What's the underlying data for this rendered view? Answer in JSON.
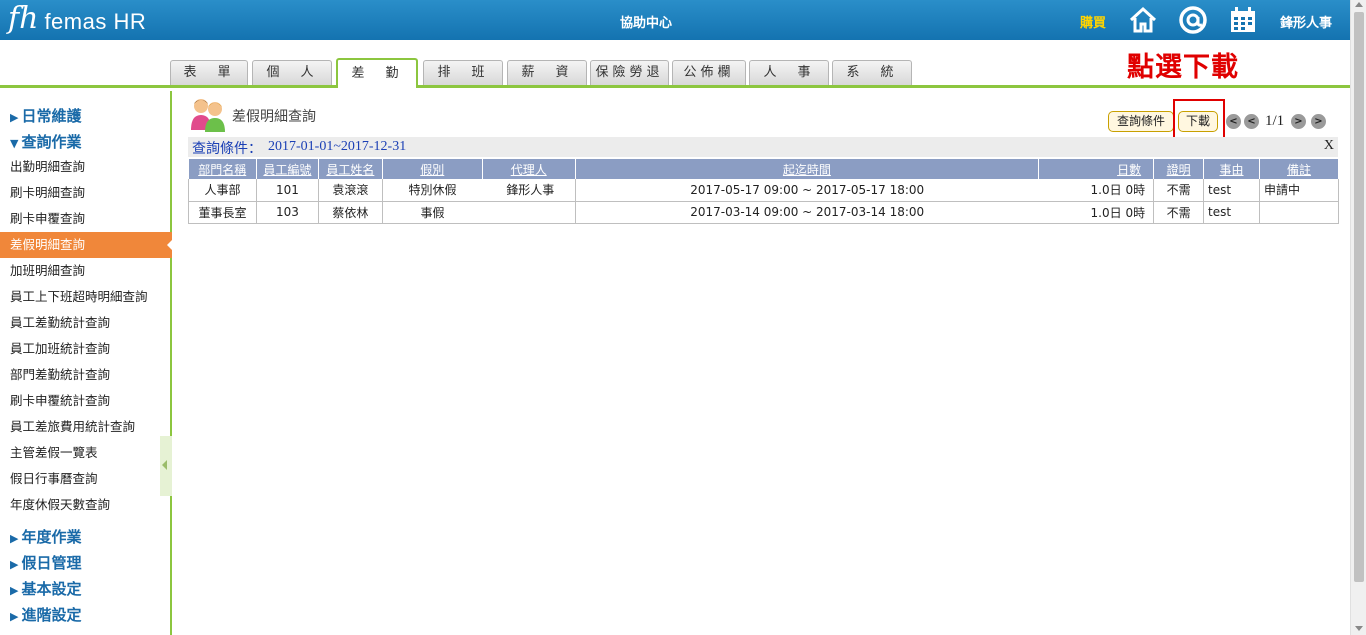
{
  "header": {
    "logo_mark": "fh",
    "logo_text": "femas HR",
    "title": "協助中心",
    "buy": "購買",
    "user": "鋒形人事"
  },
  "tabs": [
    {
      "label": "表　單"
    },
    {
      "label": "個　人"
    },
    {
      "label": "差　勤",
      "active": true
    },
    {
      "label": "排　班"
    },
    {
      "label": "薪　資"
    },
    {
      "label": "保險勞退"
    },
    {
      "label": "公佈欄"
    },
    {
      "label": "人　事"
    },
    {
      "label": "系　統"
    }
  ],
  "annotation": "點選下載",
  "sidebar": {
    "sections_top": [
      {
        "label": "日常維護"
      },
      {
        "label": "查詢作業"
      }
    ],
    "items": [
      "出勤明細查詢",
      "刷卡明細查詢",
      "刷卡申覆查詢",
      "差假明細查詢",
      "加班明細查詢",
      "員工上下班超時明細查詢",
      "員工差勤統計查詢",
      "員工加班統計查詢",
      "部門差勤統計查詢",
      "刷卡申覆統計查詢",
      "員工差旅費用統計查詢",
      "主管差假一覽表",
      "假日行事曆查詢",
      "年度休假天數查詢"
    ],
    "active_item": "差假明細查詢",
    "sections_bottom": [
      {
        "label": "年度作業"
      },
      {
        "label": "假日管理"
      },
      {
        "label": "基本設定"
      },
      {
        "label": "進階設定"
      }
    ]
  },
  "page": {
    "title": "差假明細查詢",
    "query_button": "查詢條件",
    "download_button": "下載",
    "pagination": "1/1",
    "criteria_label": "查詢條件：",
    "criteria_value": "2017-01-01~2017-12-31",
    "criteria_close": "X"
  },
  "table": {
    "headers": [
      "部門名稱",
      "員工編號",
      "員工姓名",
      "假別",
      "代理人",
      "起迄時間",
      "日數",
      "證明",
      "事由",
      "備註"
    ],
    "rows": [
      [
        "人事部",
        "101",
        "袁滾滾",
        "特別休假",
        "鋒形人事",
        "2017-05-17 09:00 ~ 2017-05-17 18:00",
        "1.0日 0時",
        "不需",
        "test",
        "申請中"
      ],
      [
        "董事長室",
        "103",
        "蔡依林",
        "事假",
        "",
        "2017-03-14 09:00 ~ 2017-03-14 18:00",
        "1.0日 0時",
        "不需",
        "test",
        ""
      ]
    ]
  },
  "colors": {
    "header_bg": "#1473b0",
    "accent_green": "#8cc63f",
    "active_orange": "#f0873a",
    "table_header": "#8b9dc3",
    "annotation_red": "#e00000"
  }
}
